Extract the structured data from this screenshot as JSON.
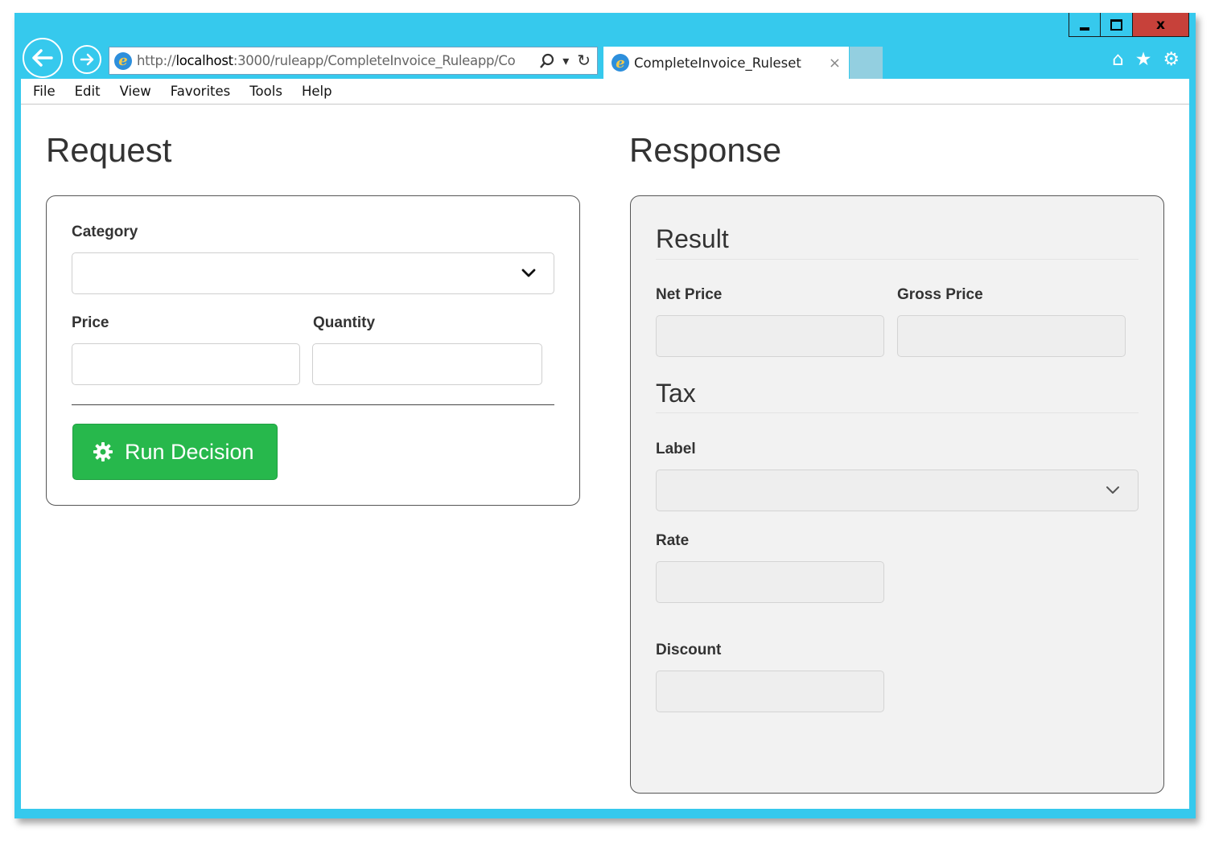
{
  "browser": {
    "url_prefix": "http://",
    "url_host": "localhost",
    "url_rest": ":3000/ruleapp/CompleteInvoice_Ruleapp/Co",
    "tab_title": "CompleteInvoice_Ruleset",
    "tab_close": "×",
    "search_glyph": "⚲",
    "dropdown_glyph": "▾",
    "refresh_glyph": "↻",
    "home_glyph": "⌂",
    "favorites_glyph": "★",
    "settings_glyph": "⚙",
    "close_glyph": "x",
    "ie_glyph": "e",
    "back_glyph": "←",
    "forward_glyph": "→"
  },
  "menu": [
    "File",
    "Edit",
    "View",
    "Favorites",
    "Tools",
    "Help"
  ],
  "request": {
    "title": "Request",
    "category_label": "Category",
    "category_value": "",
    "price_label": "Price",
    "price_value": "",
    "quantity_label": "Quantity",
    "quantity_value": "",
    "run_button_label": "Run Decision",
    "run_button_icon": "gear-icon"
  },
  "response": {
    "title": "Response",
    "result_heading": "Result",
    "net_price_label": "Net Price",
    "net_price_value": "",
    "gross_price_label": "Gross Price",
    "gross_price_value": "",
    "tax_heading": "Tax",
    "tax_label_label": "Label",
    "tax_label_value": "",
    "rate_label": "Rate",
    "rate_value": "",
    "discount_label": "Discount",
    "discount_value": ""
  },
  "colors": {
    "window_frame": "#36c9ed",
    "close_button": "#c7413a",
    "run_button": "#27b84c",
    "readonly_field": "#eeeeee",
    "response_panel": "#f2f2f2"
  }
}
